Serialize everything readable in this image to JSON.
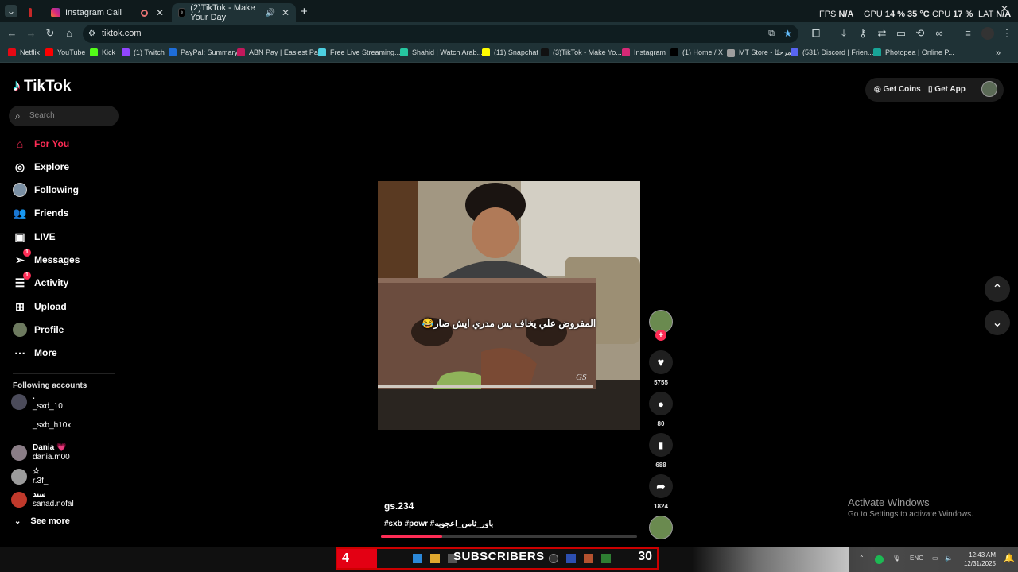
{
  "browser": {
    "tabs": [
      {
        "label": "",
        "active": false
      },
      {
        "label": "Instagram Call",
        "active": false
      },
      {
        "label": "(2)TikTok - Make Your Day",
        "active": true
      }
    ],
    "new_tab": "+",
    "url": "tiktok.com",
    "perf": {
      "fps_label": "FPS",
      "fps_value": "N/A",
      "gpu_label": "GPU",
      "gpu_value": "14 % 35 °C",
      "cpu_label": "CPU",
      "cpu_value": "17 %",
      "lat_label": "LAT",
      "lat_value": "N/A"
    },
    "bookmarks": [
      {
        "label": "Netflix",
        "color": "#e50914"
      },
      {
        "label": "YouTube",
        "color": "#ff0000"
      },
      {
        "label": "Kick",
        "color": "#53fc18"
      },
      {
        "label": "(1) Twitch",
        "color": "#9146ff"
      },
      {
        "label": "PayPal: Summary",
        "color": "#1e6dd8"
      },
      {
        "label": "ABN Pay | Easiest Pa...",
        "color": "#c2185b"
      },
      {
        "label": "Free Live Streaming...",
        "color": "#4dd0e1"
      },
      {
        "label": "Shahid | Watch Arab...",
        "color": "#26c6a0"
      },
      {
        "label": "(11) Snapchat",
        "color": "#fffc00"
      },
      {
        "label": "(3)TikTok - Make Yo...",
        "color": "#111111"
      },
      {
        "label": "Instagram",
        "color": "#d62976"
      },
      {
        "label": "(1) Home / X",
        "color": "#000000"
      },
      {
        "label": "MT Store - مرحبًا",
        "color": "#9e9e9e"
      },
      {
        "label": "(531) Discord | Frien...",
        "color": "#5865f2"
      },
      {
        "label": "Photopea | Online P...",
        "color": "#18a497"
      }
    ]
  },
  "tiktok": {
    "logo": "TikTok",
    "search_placeholder": "Search",
    "nav": [
      {
        "label": "For You",
        "icon": "home-icon",
        "active": true
      },
      {
        "label": "Explore",
        "icon": "compass-icon"
      },
      {
        "label": "Following",
        "icon": "following-avatar-icon"
      },
      {
        "label": "Friends",
        "icon": "friends-icon"
      },
      {
        "label": "LIVE",
        "icon": "live-icon"
      },
      {
        "label": "Messages",
        "icon": "messages-icon",
        "badge": "1"
      },
      {
        "label": "Activity",
        "icon": "activity-icon",
        "badge": "1"
      },
      {
        "label": "Upload",
        "icon": "upload-icon"
      },
      {
        "label": "Profile",
        "icon": "profile-icon"
      },
      {
        "label": "More",
        "icon": "more-icon"
      }
    ],
    "following_title": "Following accounts",
    "accounts": [
      {
        "display": ".",
        "handle": "_sxd_10"
      },
      {
        "display": "",
        "handle": "_sxb_h10x"
      },
      {
        "display": "Dania 💗",
        "handle": "dania.m00"
      },
      {
        "display": "☆",
        "handle": "r.3f_"
      },
      {
        "display": "سند",
        "handle": "sanad.nofal"
      }
    ],
    "see_more": "See more",
    "get_coins": "Get Coins",
    "get_app": "Get App",
    "video": {
      "overlay_text": "المفروض علي يخاف بس مدري ايش صار😂",
      "watermark": "GS",
      "author": "gs.234",
      "description": "#sxb #powr #باور_ثامن_اعجوبه",
      "progress": 0.24
    },
    "actions": {
      "likes": "5755",
      "comments": "80",
      "saves": "688",
      "shares": "1824"
    }
  },
  "activate": {
    "title": "Activate Windows",
    "subtitle": "Go to Settings to activate Windows."
  },
  "taskbar": {
    "sub_left": "4",
    "sub_text": "SUBSCRIBERS",
    "sub_right": "30",
    "lang": "ENG",
    "time": "12:43 AM",
    "date": "12/31/2025"
  }
}
